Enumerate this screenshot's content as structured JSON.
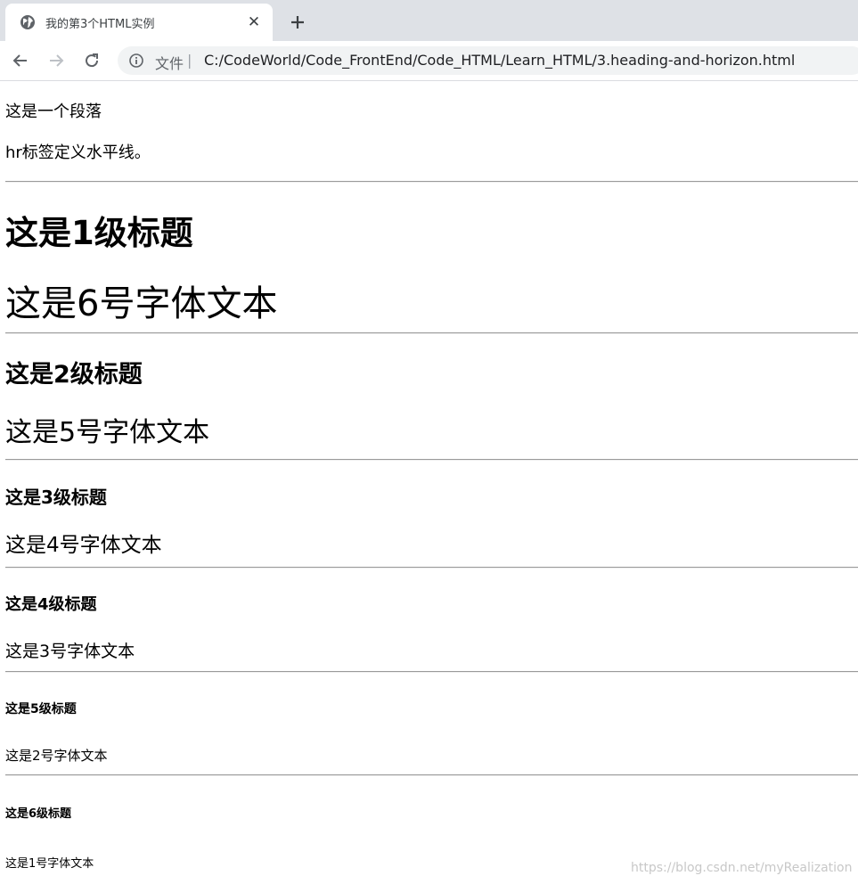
{
  "browser": {
    "tab_title": "我的第3个HTML实例",
    "file_label": "文件",
    "separator": "|",
    "url": "C:/CodeWorld/Code_FrontEnd/Code_HTML/Learn_HTML/3.heading-and-horizon.html"
  },
  "page": {
    "para1": "这是一个段落",
    "para2": "hr标签定义水平线。",
    "sections": [
      {
        "heading": "这是1级标题",
        "text": "这是6号字体文本"
      },
      {
        "heading": "这是2级标题",
        "text": "这是5号字体文本"
      },
      {
        "heading": "这是3级标题",
        "text": "这是4号字体文本"
      },
      {
        "heading": "这是4级标题",
        "text": "这是3号字体文本"
      },
      {
        "heading": "这是5级标题",
        "text": "这是2号字体文本"
      },
      {
        "heading": "这是6级标题",
        "text": "这是1号字体文本"
      }
    ],
    "watermark": "https://blog.csdn.net/myRealization"
  }
}
